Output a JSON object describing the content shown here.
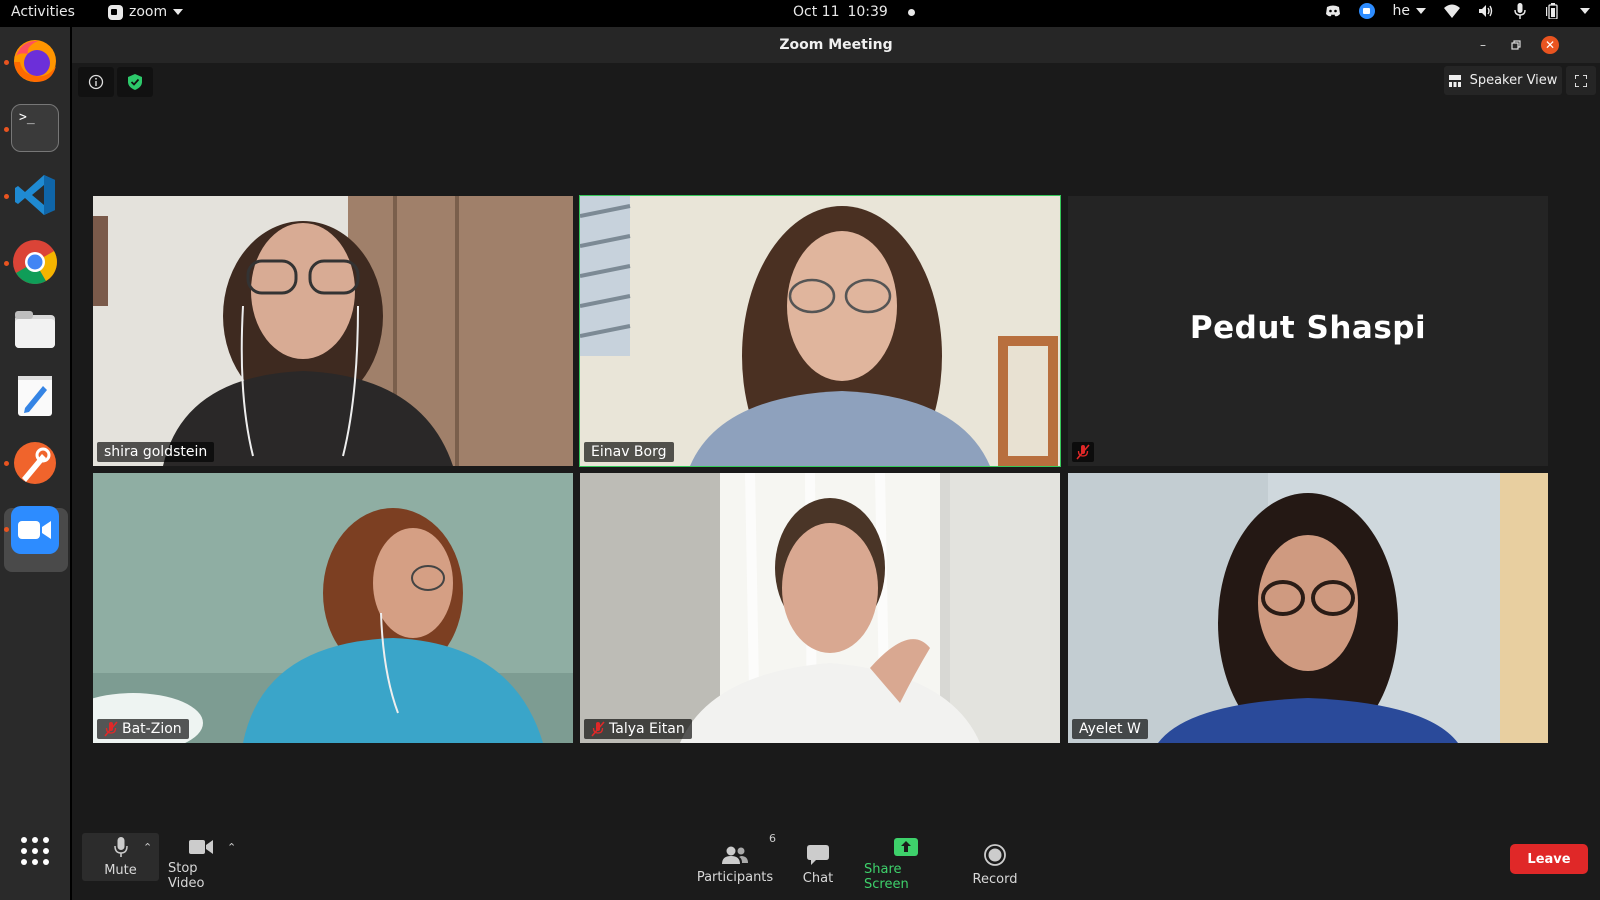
{
  "topbar": {
    "activities": "Activities",
    "app_name": "zoom",
    "date": "Oct 11",
    "time": "10:39",
    "language": "he"
  },
  "window": {
    "title": "Zoom Meeting",
    "speaker_view_label": "Speaker View"
  },
  "participants": [
    {
      "name": "shira goldstein",
      "muted": false,
      "video": true
    },
    {
      "name": "Einav Borg",
      "muted": false,
      "video": true,
      "active_speaker": true
    },
    {
      "name": "Pedut Shaspi",
      "muted": true,
      "video": false
    },
    {
      "name": "Bat-Zion",
      "muted": true,
      "video": true
    },
    {
      "name": "Talya Eitan",
      "muted": true,
      "video": true
    },
    {
      "name": "Ayelet W",
      "muted": false,
      "video": true
    }
  ],
  "toolbar": {
    "mute_label": "Mute",
    "stop_video_label": "Stop Video",
    "participants_label": "Participants",
    "participants_count": "6",
    "chat_label": "Chat",
    "share_label": "Share Screen",
    "record_label": "Record",
    "leave_label": "Leave"
  },
  "dock": {
    "apps": [
      "firefox-icon",
      "terminal-icon",
      "vscode-icon",
      "chrome-icon",
      "files-icon",
      "text-editor-icon",
      "inkscape-icon",
      "zoom-icon"
    ],
    "show_apps": "show-applications-icon"
  },
  "colors": {
    "active_speaker_border": "#35c759",
    "leave_red": "#e02828",
    "share_green": "#3ed16b",
    "zoom_blue": "#2d8cff"
  }
}
